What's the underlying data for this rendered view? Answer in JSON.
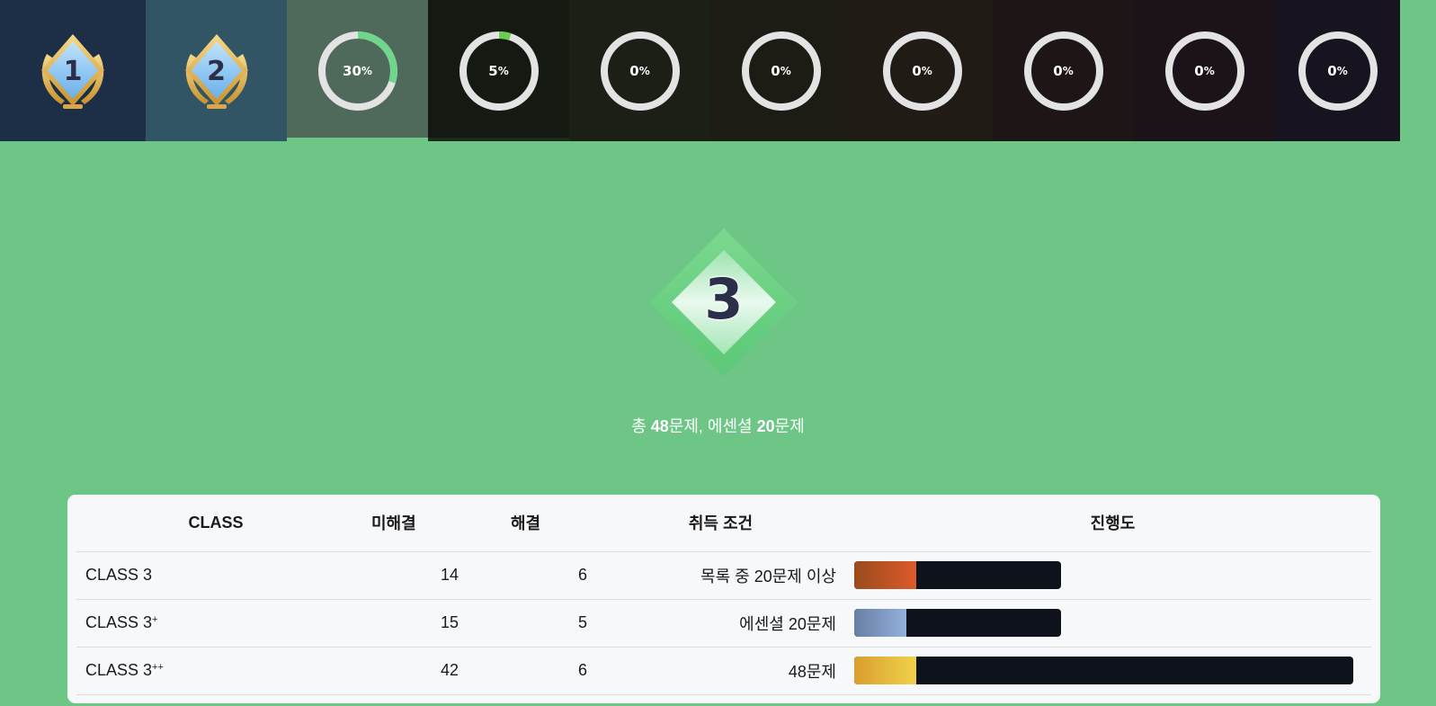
{
  "tabs": [
    {
      "type": "medal",
      "label": "1",
      "bg": "#1d2f47",
      "medal_color": "#8fc6f2"
    },
    {
      "type": "medal",
      "label": "2",
      "bg": "#315565",
      "medal_color": "#8fc6f2"
    },
    {
      "type": "ring",
      "percent_text": "30",
      "percent": 30,
      "bg": "#4f6a5a",
      "ring_color": "#6fd68c",
      "selected": true
    },
    {
      "type": "ring",
      "percent_text": "5",
      "percent": 5,
      "bg": "#141a12",
      "ring_color": "#6dcc52"
    },
    {
      "type": "ring",
      "percent_text": "0",
      "percent": 0,
      "bg": "#1c1f16"
    },
    {
      "type": "ring",
      "percent_text": "0",
      "percent": 0,
      "bg": "#1d1c14"
    },
    {
      "type": "ring",
      "percent_text": "0",
      "percent": 0,
      "bg": "#201b15"
    },
    {
      "type": "ring",
      "percent_text": "0",
      "percent": 0,
      "bg": "#1d1516"
    },
    {
      "type": "ring",
      "percent_text": "0",
      "percent": 0,
      "bg": "#1c1219"
    },
    {
      "type": "ring",
      "percent_text": "0",
      "percent": 0,
      "bg": "#17131f"
    }
  ],
  "percent_sign": "%",
  "emblem": {
    "label": "3"
  },
  "summary": {
    "prefix": "총 ",
    "total": "48",
    "mid": "문제, 에센셜 ",
    "essential": "20",
    "suffix": "문제"
  },
  "table": {
    "headers": {
      "class": "CLASS",
      "unsolved": "미해결",
      "solved": "해결",
      "condition": "취득 조건",
      "progress": "진행도"
    },
    "rows": [
      {
        "class": "CLASS 3",
        "sup": "",
        "unsolved": "14",
        "solved": "6",
        "condition": "목록 중 20문제 이상",
        "progress": 0.3,
        "bar_scale": 0.415,
        "fill_from": "#9a4b1d",
        "fill_to": "#dc5a2a"
      },
      {
        "class": "CLASS 3",
        "sup": "+",
        "unsolved": "15",
        "solved": "5",
        "condition": "에센셜 20문제",
        "progress": 0.25,
        "bar_scale": 0.415,
        "fill_from": "#6a7ea3",
        "fill_to": "#92b0dc"
      },
      {
        "class": "CLASS 3",
        "sup": "++",
        "unsolved": "42",
        "solved": "6",
        "condition": "48문제",
        "progress": 0.125,
        "bar_scale": 1.0,
        "fill_from": "#d99e2f",
        "fill_to": "#f0d24a"
      }
    ]
  }
}
